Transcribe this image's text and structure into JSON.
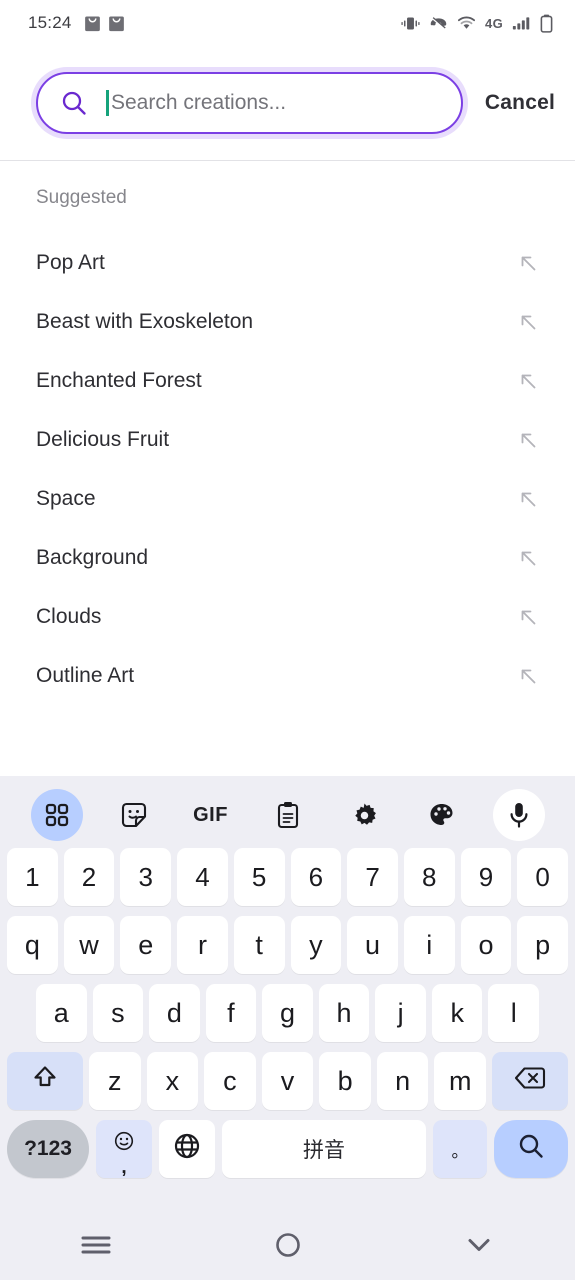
{
  "statusbar": {
    "time": "15:24",
    "left_icons": [
      "shopping-bag-icon",
      "shopping-bag-icon"
    ],
    "right_icons": [
      "vibrate-icon",
      "call-mute-icon",
      "wifi-icon"
    ],
    "network_label": "4G",
    "signal_icon": "signal-bars-icon",
    "battery_icon": "battery-icon"
  },
  "search": {
    "placeholder": "Search creations...",
    "value": "",
    "icon": "search-icon",
    "cancel_label": "Cancel",
    "border_color": "#7b3fe4",
    "caret_color": "#16a37b"
  },
  "suggestions": {
    "title": "Suggested",
    "row_icon": "arrow-up-left-icon",
    "items": [
      {
        "label": "Pop Art"
      },
      {
        "label": "Beast with Exoskeleton"
      },
      {
        "label": "Enchanted Forest"
      },
      {
        "label": "Delicious Fruit"
      },
      {
        "label": "Space"
      },
      {
        "label": "Background"
      },
      {
        "label": "Clouds"
      },
      {
        "label": "Outline Art"
      }
    ]
  },
  "keyboard": {
    "toolbar": [
      {
        "name": "grid-icon",
        "active": true
      },
      {
        "name": "sticker-icon",
        "active": false
      },
      {
        "name": "gif-icon",
        "label": "GIF",
        "active": false
      },
      {
        "name": "clipboard-icon",
        "active": false
      },
      {
        "name": "gear-icon",
        "active": false
      },
      {
        "name": "palette-icon",
        "active": false
      },
      {
        "name": "microphone-icon",
        "active": false
      }
    ],
    "row_numbers": [
      "1",
      "2",
      "3",
      "4",
      "5",
      "6",
      "7",
      "8",
      "9",
      "0"
    ],
    "row_top": [
      "q",
      "w",
      "e",
      "r",
      "t",
      "y",
      "u",
      "i",
      "o",
      "p"
    ],
    "row_home": [
      "a",
      "s",
      "d",
      "f",
      "g",
      "h",
      "j",
      "k",
      "l"
    ],
    "row_bottom": [
      "z",
      "x",
      "c",
      "v",
      "b",
      "n",
      "m"
    ],
    "shift_label": "shift-icon",
    "backspace_label": "backspace-icon",
    "symbols_label": "?123",
    "emoji_label": "emoji-icon",
    "comma_label": ",",
    "globe_label": "globe-icon",
    "space_label": "拼音",
    "period_label": "。",
    "enter_label": "search-icon",
    "key_bg": "#ffffff",
    "mod_bg": "#d7e0f8",
    "accent_bg": "#b7ceff",
    "background": "#eeeef4"
  },
  "navbar": {
    "recents_icon": "menu-icon",
    "home_icon": "circle-icon",
    "back_icon": "chevron-down-icon"
  }
}
